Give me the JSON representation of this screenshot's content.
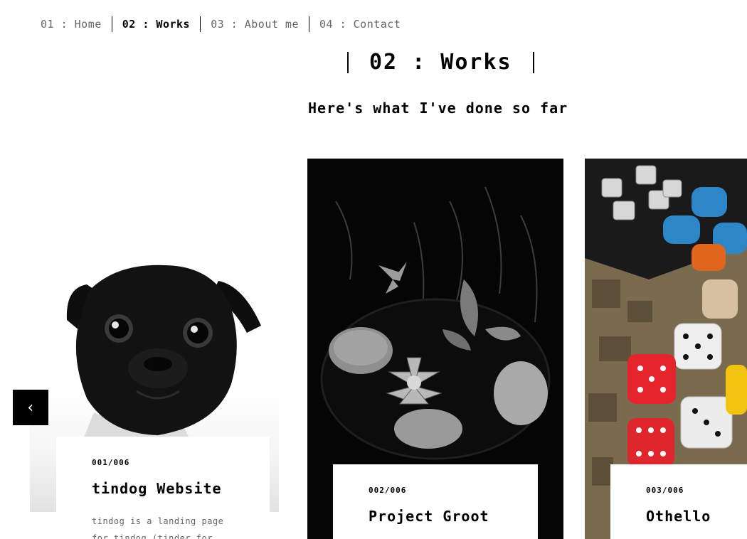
{
  "nav": {
    "items": [
      {
        "label": "01 : Home"
      },
      {
        "label": "02 : Works"
      },
      {
        "label": "03 : About me"
      },
      {
        "label": "04 : Contact"
      }
    ]
  },
  "header": {
    "title": "02 : Works",
    "subtitle": "Here's what I've done so far"
  },
  "carousel": {
    "prev_icon": "‹",
    "cards": [
      {
        "number": "001/006",
        "title": "tindog Website",
        "description": "tindog is a landing page for tindog (tinder for",
        "image": "black-pug-photo"
      },
      {
        "number": "002/006",
        "title": "Project Groot",
        "description": "",
        "image": "succulent-plants-photo"
      },
      {
        "number": "003/006",
        "title": "Othello",
        "description": "",
        "image": "board-game-dice-photo"
      }
    ]
  },
  "colors": {
    "text": "#000000",
    "muted": "#666666",
    "background": "#ffffff",
    "button": "#000000"
  }
}
